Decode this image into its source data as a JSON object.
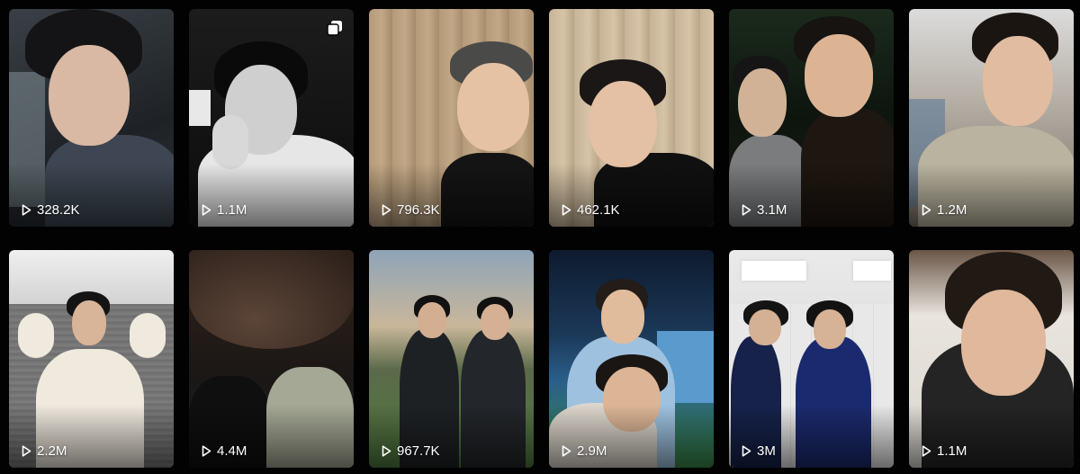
{
  "videos": [
    {
      "views": "328.2K"
    },
    {
      "views": "1.1M",
      "multi_photo": true
    },
    {
      "views": "796.3K"
    },
    {
      "views": "462.1K"
    },
    {
      "views": "3.1M"
    },
    {
      "views": "1.2M"
    },
    {
      "views": "2.2M"
    },
    {
      "views": "4.4M"
    },
    {
      "views": "967.7K"
    },
    {
      "views": "2.9M"
    },
    {
      "views": "3M"
    },
    {
      "views": "1.1M"
    }
  ],
  "icons": {
    "play": "play-icon",
    "multi": "multi-photo-icon"
  },
  "colors": {
    "page_bg": "#020202",
    "label": "#ffffff"
  }
}
